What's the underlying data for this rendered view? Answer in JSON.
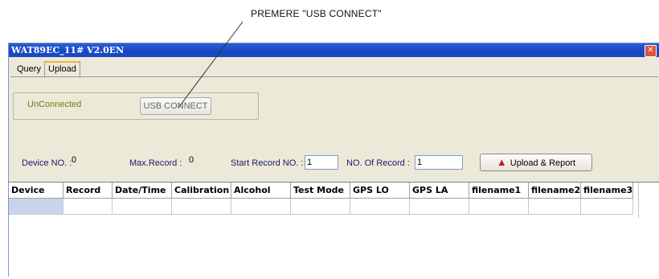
{
  "annotation": "PREMERE \"USB CONNECT\"",
  "window": {
    "title": "WAT89EC_11# V2.0EN",
    "close_glyph": "✕"
  },
  "tabs": [
    {
      "label": "Query"
    },
    {
      "label": "Upload"
    }
  ],
  "connection": {
    "status": "UnConnected",
    "usb_button": "USB CONNECT"
  },
  "fields": {
    "device_no": {
      "label": "Device NO. :",
      "value": "0"
    },
    "max_record": {
      "label": "Max.Record :",
      "value": "0"
    },
    "start_record": {
      "label": "Start Record NO. :",
      "value": "1"
    },
    "no_of_record": {
      "label": "NO. Of Record :",
      "value": "1"
    }
  },
  "upload_button": {
    "label": "Upload & Report",
    "icon": "up-arrow-icon",
    "icon_color": "#cc1b1b"
  },
  "table": {
    "columns": [
      "Device",
      "Record",
      "Date/Time",
      "Calibration",
      "Alcohol",
      "Test Mode",
      "GPS LO",
      "GPS LA",
      "filename1",
      "filename2",
      "filename3"
    ],
    "rows": [
      [
        "",
        "",
        "",
        "",
        "",
        "",
        "",
        "",
        "",
        "",
        ""
      ]
    ]
  },
  "colors": {
    "title_bar": "#1748c4",
    "status_text": "#6b7f14",
    "selected_cell": "#c9d4ec"
  }
}
